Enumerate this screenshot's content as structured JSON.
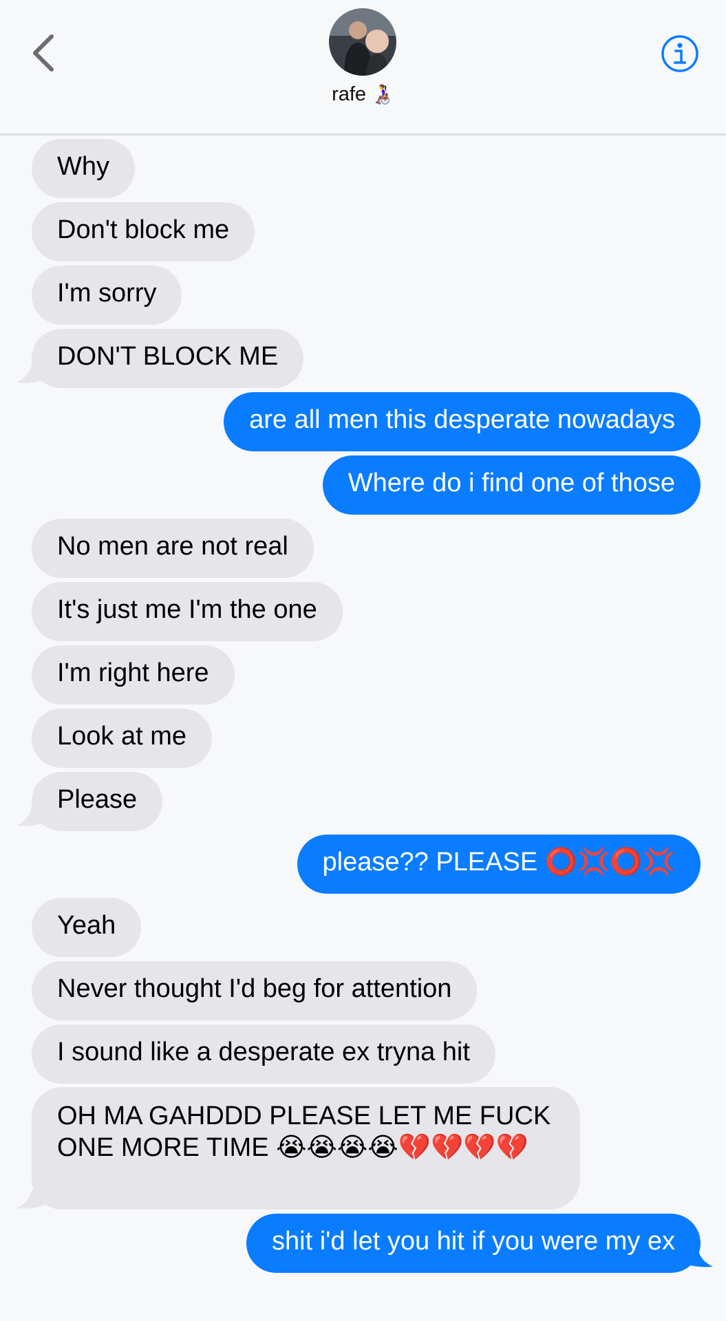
{
  "header": {
    "contact_name": "rafe",
    "contact_emoji": "👩‍🦽",
    "back_icon": "chevron-left-icon",
    "info_icon": "info-icon"
  },
  "messages": [
    {
      "from": "them",
      "text": "Why"
    },
    {
      "from": "them",
      "text": "Don't block me"
    },
    {
      "from": "them",
      "text": "I'm sorry"
    },
    {
      "from": "them",
      "text": "DON'T BLOCK ME"
    },
    {
      "from": "me",
      "text": "are all men this desperate nowadays"
    },
    {
      "from": "me",
      "text": "Where do i find one of those"
    },
    {
      "from": "them",
      "text": "No men are not real"
    },
    {
      "from": "them",
      "text": "It's just me I'm the one"
    },
    {
      "from": "them",
      "text": "I'm right here"
    },
    {
      "from": "them",
      "text": "Look at me"
    },
    {
      "from": "them",
      "text": "Please"
    },
    {
      "from": "me",
      "text": "please?? PLEASE ⭕💢⭕💢"
    },
    {
      "from": "them",
      "text": "Yeah"
    },
    {
      "from": "them",
      "text": "Never thought I'd beg for attention"
    },
    {
      "from": "them",
      "text": "I sound like a desperate ex tryna hit"
    },
    {
      "from": "them",
      "text": "OH MA GAHDDD PLEASE LET ME FUCK ONE MORE TIME 😭😭😭😭💔💔💔💔"
    },
    {
      "from": "me",
      "text": "shit i'd let you hit if you were my ex"
    }
  ],
  "colors": {
    "incoming_bubble": "#e5e5ea",
    "outgoing_bubble": "#0a7cff",
    "background": "#f7f8fa",
    "accent": "#0a7cff"
  }
}
